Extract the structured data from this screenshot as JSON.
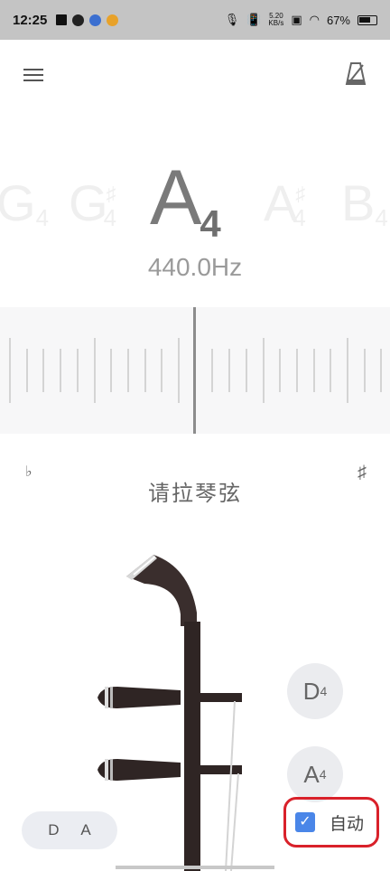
{
  "status_bar": {
    "time": "12:25",
    "net_speed_value": "5.20",
    "net_speed_unit": "KB/s",
    "battery": "67%"
  },
  "notes": {
    "left2": {
      "letter": "G",
      "octave": "4",
      "accidental": ""
    },
    "left1": {
      "letter": "G",
      "octave": "4",
      "accidental": "♯"
    },
    "current": {
      "letter": "A",
      "octave": "4"
    },
    "right1": {
      "letter": "A",
      "octave": "4",
      "accidental": "♯"
    },
    "right2": {
      "letter": "B",
      "octave": "4",
      "accidental": ""
    }
  },
  "frequency": "440.0Hz",
  "scale": {
    "flat_symbol": "♭",
    "sharp_symbol": "♯"
  },
  "prompt": "请拉琴弦",
  "strings": [
    {
      "letter": "D",
      "octave": "4"
    },
    {
      "letter": "A",
      "octave": "4"
    }
  ],
  "tuning_label": "D A",
  "auto": {
    "label": "自动",
    "checked": true
  },
  "colors": {
    "accent_checkbox": "#4a86e8",
    "highlight_box": "#d9212a",
    "note_main": "#7a7a7a"
  },
  "icons": [
    "menu-icon",
    "metronome-icon",
    "erhu-instrument-illustration"
  ]
}
